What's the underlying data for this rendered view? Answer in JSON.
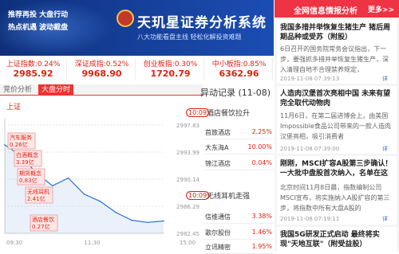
{
  "banner": {
    "slogan_lines": [
      "推荐再投 大盘行动",
      "热点机遇 波动截盘"
    ],
    "title": "天玑星证券分析系统",
    "subtitle": "八大功能看盘主线  轻松化解投资难题"
  },
  "indices": [
    {
      "name": "上证指数:0.24%",
      "value": "2985.92"
    },
    {
      "name": "深证成指:0.52%",
      "value": "9968.90"
    },
    {
      "name": "创业板指:0.30%",
      "value": "1720.79"
    },
    {
      "name": "中小板指:0.85%",
      "value": "6362.96"
    }
  ],
  "tabs": [
    "竞价分析",
    "大盘分时"
  ],
  "chart_data": {
    "type": "line",
    "title": "上证",
    "x_ticks": [
      "09:30",
      "11:30",
      "15:00"
    ],
    "y_ticks": [
      "2997.83",
      "2993.99",
      "2990.14",
      "2986.29",
      "2982.45"
    ],
    "ylim": [
      2982.45,
      2997.83
    ],
    "x": [
      0,
      3,
      6,
      9,
      12,
      15,
      18,
      21,
      24,
      27,
      30
    ],
    "y": [
      2995.0,
      2993.5,
      2991.0,
      2989.2,
      2990.3,
      2988.0,
      2987.0,
      2985.4,
      2984.3,
      2984.0,
      2984.2
    ],
    "annotations": [
      {
        "text": "汽车服务",
        "amount": "0.26亿"
      },
      {
        "text": "白酒概念",
        "amount": "3.39亿"
      },
      {
        "text": "期货概念",
        "amount": "0.83亿"
      },
      {
        "text": "无线耳机",
        "amount": "2.41亿"
      },
      {
        "text": "酒店餐饮",
        "amount": "0.27亿"
      }
    ]
  },
  "events": {
    "title": "异动记录 (11-08)",
    "groups": [
      {
        "time": "10:09",
        "name": "酒店餐饮拉升",
        "stocks": [
          {
            "name": "首旅酒店",
            "pct": "2.25%"
          },
          {
            "name": "大东海A",
            "pct": "10.00%"
          },
          {
            "name": "锦江酒店",
            "pct": "0.04%"
          }
        ]
      },
      {
        "time": "10:09",
        "name": "无线耳机走强",
        "stocks": [
          {
            "name": "信维通信",
            "pct": "3.38%"
          },
          {
            "name": "歌尔股份",
            "pct": "1.46%"
          },
          {
            "name": "立讯精密",
            "pct": "1.95%"
          }
        ]
      }
    ]
  },
  "news": {
    "header": "全网信息情报分析",
    "more": "更多>>",
    "items": [
      {
        "headline": "我国多措并举恢复生猪生产 猪后周期品种或受苏（附股）",
        "body": "6日召开的国务院常务会议指出，下一步，要强抓多措并举恢复生猪生产，深入清理自地不合理禁养规定，",
        "date": "2019-11-08 07:39:13",
        "icon": "详"
      },
      {
        "headline": "人造肉汉堡首次亮相中国 未来有望完全取代动物肉",
        "body": "11月6日，在第二届进博会上，由美国Impossible食品公司带来的一款人造肉汉堡亮相，吸引消费者",
        "date": "2019-11-08 07:39:00",
        "icon": "详"
      },
      {
        "headline": "刚刚，MSCI扩容A股第三步确认！一大批中盘股首次纳入，名单在这",
        "body": "北京时间11月8日晨，指数编制公司MSCI宣布，将实施纳入A股扩容的第三步，将指数中所有大盘A股的",
        "date": "2019-11-08 07:19:11",
        "icon": "详"
      },
      {
        "headline": "我国5G研发正式启动 最终将实现\"天地互联\"（附受益股）",
        "body": "",
        "date": "",
        "icon": ""
      }
    ]
  },
  "colors": {
    "up": "#dd2211",
    "banner": "#153e96",
    "news_header": "#ee3344"
  }
}
